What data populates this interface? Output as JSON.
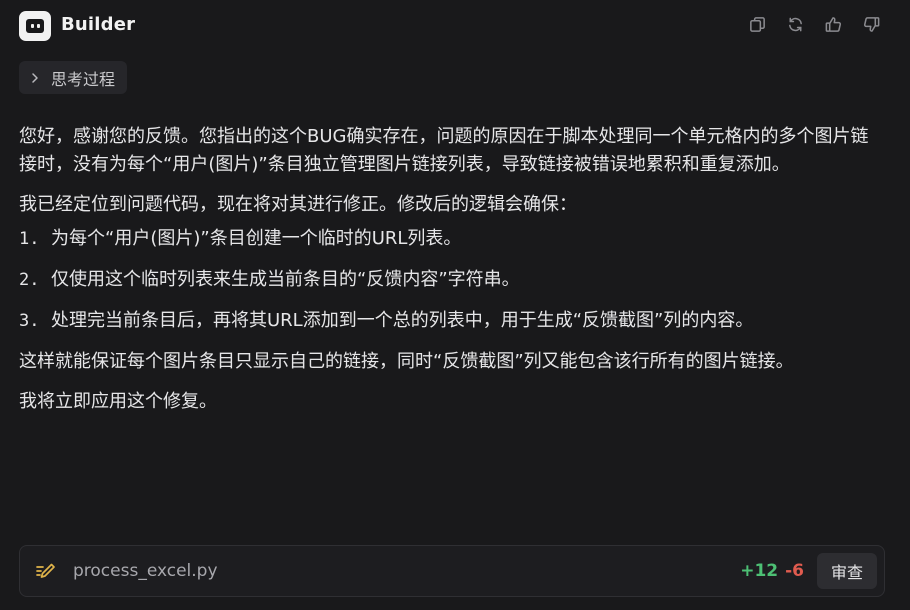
{
  "header": {
    "title": "Builder",
    "actions": [
      {
        "name": "copy-icon"
      },
      {
        "name": "refresh-icon"
      },
      {
        "name": "thumbs-up-icon"
      },
      {
        "name": "thumbs-down-icon"
      }
    ]
  },
  "thinking": {
    "label": "思考过程",
    "icon": "chevron-right-icon"
  },
  "message": {
    "paragraph1": "您好，感谢您的反馈。您指出的这个BUG确实存在，问题的原因在于脚本处理同一个单元格内的多个图片链接时，没有为每个“用户(图片)”条目独立管理图片链接列表，导致链接被错误地累积和重复添加。",
    "paragraph2": "我已经定位到问题代码，现在将对其进行修正。修改后的逻辑会确保：",
    "list": [
      {
        "num": "1.",
        "text": "为每个“用户(图片)”条目创建一个临时的URL列表。"
      },
      {
        "num": "2.",
        "text": "仅使用这个临时列表来生成当前条目的“反馈内容”字符串。"
      },
      {
        "num": "3.",
        "text": "处理完当前条目后，再将其URL添加到一个总的列表中，用于生成“反馈截图”列的内容。"
      }
    ],
    "paragraph3": "这样就能保证每个图片条目只显示自己的链接，同时“反馈截图”列又能包含该行所有的图片链接。",
    "paragraph4": "我将立即应用这个修复。"
  },
  "file": {
    "name": "process_excel.py",
    "added": "+12",
    "removed": "-6",
    "review_label": "审查",
    "icon": "edit-file-icon"
  },
  "colors": {
    "background": "#19191b",
    "added": "#4dbf74",
    "removed": "#e05b4f"
  }
}
